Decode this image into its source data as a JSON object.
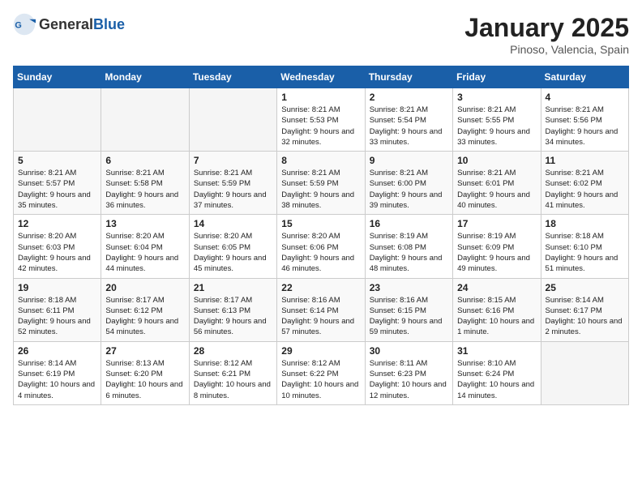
{
  "header": {
    "logo_general": "General",
    "logo_blue": "Blue",
    "title": "January 2025",
    "location": "Pinoso, Valencia, Spain"
  },
  "weekdays": [
    "Sunday",
    "Monday",
    "Tuesday",
    "Wednesday",
    "Thursday",
    "Friday",
    "Saturday"
  ],
  "weeks": [
    [
      {
        "day": "",
        "detail": ""
      },
      {
        "day": "",
        "detail": ""
      },
      {
        "day": "",
        "detail": ""
      },
      {
        "day": "1",
        "detail": "Sunrise: 8:21 AM\nSunset: 5:53 PM\nDaylight: 9 hours and 32 minutes."
      },
      {
        "day": "2",
        "detail": "Sunrise: 8:21 AM\nSunset: 5:54 PM\nDaylight: 9 hours and 33 minutes."
      },
      {
        "day": "3",
        "detail": "Sunrise: 8:21 AM\nSunset: 5:55 PM\nDaylight: 9 hours and 33 minutes."
      },
      {
        "day": "4",
        "detail": "Sunrise: 8:21 AM\nSunset: 5:56 PM\nDaylight: 9 hours and 34 minutes."
      }
    ],
    [
      {
        "day": "5",
        "detail": "Sunrise: 8:21 AM\nSunset: 5:57 PM\nDaylight: 9 hours and 35 minutes."
      },
      {
        "day": "6",
        "detail": "Sunrise: 8:21 AM\nSunset: 5:58 PM\nDaylight: 9 hours and 36 minutes."
      },
      {
        "day": "7",
        "detail": "Sunrise: 8:21 AM\nSunset: 5:59 PM\nDaylight: 9 hours and 37 minutes."
      },
      {
        "day": "8",
        "detail": "Sunrise: 8:21 AM\nSunset: 5:59 PM\nDaylight: 9 hours and 38 minutes."
      },
      {
        "day": "9",
        "detail": "Sunrise: 8:21 AM\nSunset: 6:00 PM\nDaylight: 9 hours and 39 minutes."
      },
      {
        "day": "10",
        "detail": "Sunrise: 8:21 AM\nSunset: 6:01 PM\nDaylight: 9 hours and 40 minutes."
      },
      {
        "day": "11",
        "detail": "Sunrise: 8:21 AM\nSunset: 6:02 PM\nDaylight: 9 hours and 41 minutes."
      }
    ],
    [
      {
        "day": "12",
        "detail": "Sunrise: 8:20 AM\nSunset: 6:03 PM\nDaylight: 9 hours and 42 minutes."
      },
      {
        "day": "13",
        "detail": "Sunrise: 8:20 AM\nSunset: 6:04 PM\nDaylight: 9 hours and 44 minutes."
      },
      {
        "day": "14",
        "detail": "Sunrise: 8:20 AM\nSunset: 6:05 PM\nDaylight: 9 hours and 45 minutes."
      },
      {
        "day": "15",
        "detail": "Sunrise: 8:20 AM\nSunset: 6:06 PM\nDaylight: 9 hours and 46 minutes."
      },
      {
        "day": "16",
        "detail": "Sunrise: 8:19 AM\nSunset: 6:08 PM\nDaylight: 9 hours and 48 minutes."
      },
      {
        "day": "17",
        "detail": "Sunrise: 8:19 AM\nSunset: 6:09 PM\nDaylight: 9 hours and 49 minutes."
      },
      {
        "day": "18",
        "detail": "Sunrise: 8:18 AM\nSunset: 6:10 PM\nDaylight: 9 hours and 51 minutes."
      }
    ],
    [
      {
        "day": "19",
        "detail": "Sunrise: 8:18 AM\nSunset: 6:11 PM\nDaylight: 9 hours and 52 minutes."
      },
      {
        "day": "20",
        "detail": "Sunrise: 8:17 AM\nSunset: 6:12 PM\nDaylight: 9 hours and 54 minutes."
      },
      {
        "day": "21",
        "detail": "Sunrise: 8:17 AM\nSunset: 6:13 PM\nDaylight: 9 hours and 56 minutes."
      },
      {
        "day": "22",
        "detail": "Sunrise: 8:16 AM\nSunset: 6:14 PM\nDaylight: 9 hours and 57 minutes."
      },
      {
        "day": "23",
        "detail": "Sunrise: 8:16 AM\nSunset: 6:15 PM\nDaylight: 9 hours and 59 minutes."
      },
      {
        "day": "24",
        "detail": "Sunrise: 8:15 AM\nSunset: 6:16 PM\nDaylight: 10 hours and 1 minute."
      },
      {
        "day": "25",
        "detail": "Sunrise: 8:14 AM\nSunset: 6:17 PM\nDaylight: 10 hours and 2 minutes."
      }
    ],
    [
      {
        "day": "26",
        "detail": "Sunrise: 8:14 AM\nSunset: 6:19 PM\nDaylight: 10 hours and 4 minutes."
      },
      {
        "day": "27",
        "detail": "Sunrise: 8:13 AM\nSunset: 6:20 PM\nDaylight: 10 hours and 6 minutes."
      },
      {
        "day": "28",
        "detail": "Sunrise: 8:12 AM\nSunset: 6:21 PM\nDaylight: 10 hours and 8 minutes."
      },
      {
        "day": "29",
        "detail": "Sunrise: 8:12 AM\nSunset: 6:22 PM\nDaylight: 10 hours and 10 minutes."
      },
      {
        "day": "30",
        "detail": "Sunrise: 8:11 AM\nSunset: 6:23 PM\nDaylight: 10 hours and 12 minutes."
      },
      {
        "day": "31",
        "detail": "Sunrise: 8:10 AM\nSunset: 6:24 PM\nDaylight: 10 hours and 14 minutes."
      },
      {
        "day": "",
        "detail": ""
      }
    ]
  ]
}
